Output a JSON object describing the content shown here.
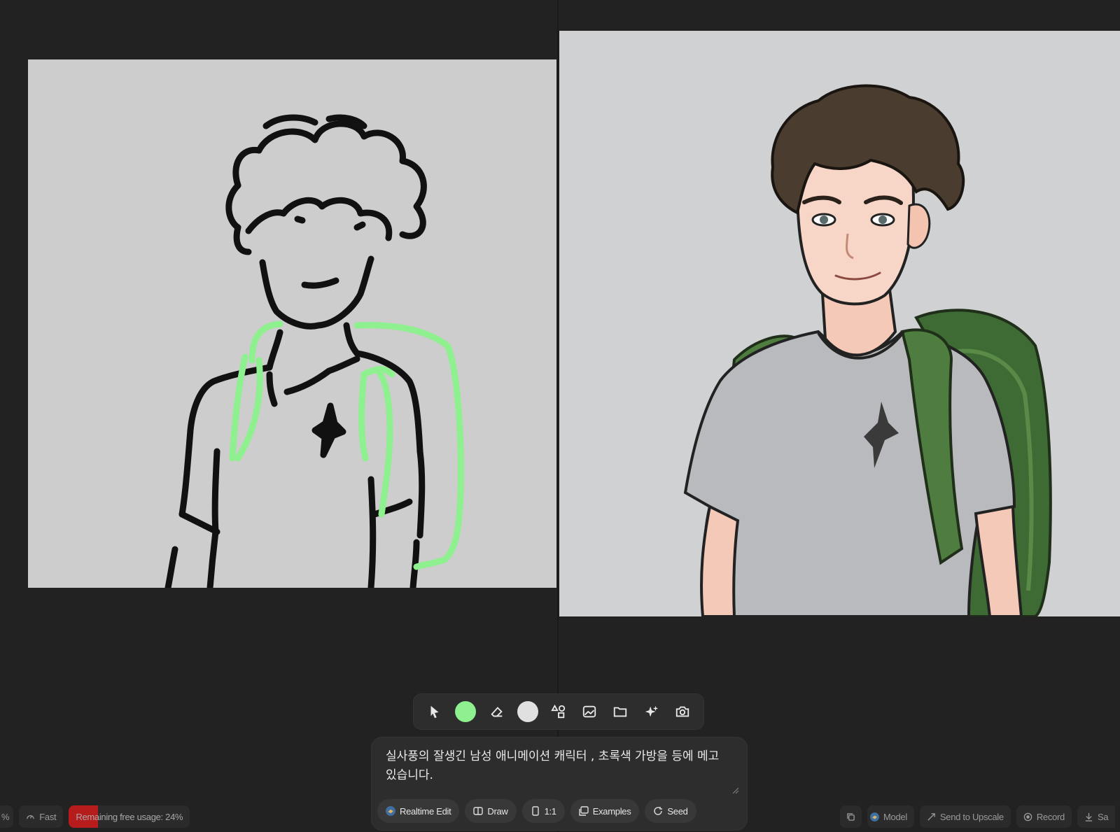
{
  "toolbar": {
    "tools": [
      {
        "name": "select-tool",
        "icon": "cursor-arrow-icon"
      },
      {
        "name": "brush-tool",
        "icon": "brush-icon",
        "color": "#8ef08e",
        "active": true
      },
      {
        "name": "eraser-tool",
        "icon": "eraser-icon"
      },
      {
        "name": "canvas-color-tool",
        "icon": "color-swatch-icon",
        "color": "#e0e0e0"
      },
      {
        "name": "shapes-tool",
        "icon": "shapes-icon"
      },
      {
        "name": "image-tool",
        "icon": "image-icon"
      },
      {
        "name": "folder-tool",
        "icon": "folder-icon"
      },
      {
        "name": "magic-tool",
        "icon": "sparkle-icon"
      },
      {
        "name": "camera-tool",
        "icon": "camera-icon"
      }
    ]
  },
  "prompt": {
    "text": "실사풍의 잘생긴 남성 애니메이션 캐릭터 , 초록색 가방을 등에 메고있습니다.",
    "pills": {
      "realtime_edit": "Realtime Edit",
      "draw": "Draw",
      "aspect": "1:1",
      "examples": "Examples",
      "seed": "Seed"
    }
  },
  "status": {
    "percent_fragment": "%",
    "speed": "Fast",
    "usage_label": "Remaining free usage: 24%",
    "usage_fraction": 0.24,
    "model": "Model",
    "send_to_upscale": "Send to Upscale",
    "record": "Record",
    "save_fragment": "Sa"
  },
  "colors": {
    "background": "#222222",
    "sketch_bg": "#cdcdcd",
    "brush_green": "#8ef08e",
    "usage_red": "#b71c1c"
  }
}
